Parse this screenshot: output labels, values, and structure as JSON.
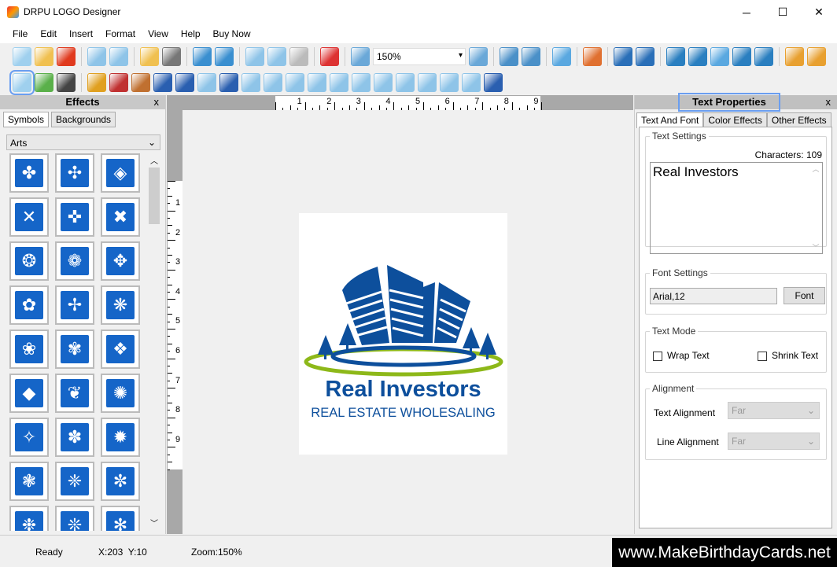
{
  "app": {
    "title": "DRPU LOGO Designer",
    "minimize": "─",
    "maximize": "☐",
    "close": "✕"
  },
  "menu": [
    "File",
    "Edit",
    "Insert",
    "Format",
    "View",
    "Help",
    "Buy Now"
  ],
  "toolbar1": [
    {
      "n": "new-icon",
      "c": "#9fd0ee"
    },
    {
      "n": "open-icon",
      "c": "#f0c050"
    },
    {
      "n": "close-file-icon",
      "c": "#e03a1e"
    },
    "|",
    {
      "n": "save-icon",
      "c": "#8ec4e8"
    },
    {
      "n": "save-as-icon",
      "c": "#8ec4e8"
    },
    "|",
    {
      "n": "export-icon",
      "c": "#f0c050"
    },
    {
      "n": "print-icon",
      "c": "#777"
    },
    "|",
    {
      "n": "undo-icon",
      "c": "#3a8fd0"
    },
    {
      "n": "redo-icon",
      "c": "#3a8fd0"
    },
    "|",
    {
      "n": "cut-icon",
      "c": "#8ec4e8"
    },
    {
      "n": "copy-icon",
      "c": "#8ec4e8"
    },
    {
      "n": "paste-icon",
      "c": "#bbb"
    },
    "|",
    {
      "n": "delete-icon",
      "c": "#d33"
    },
    "|",
    {
      "n": "zoom-in-icon",
      "c": "#6aa8d8"
    },
    "ZOOM",
    {
      "n": "zoom-out-icon",
      "c": "#6aa8d8"
    },
    "|",
    {
      "n": "actual-size-icon",
      "c": "#4a90c8"
    },
    {
      "n": "fit-icon",
      "c": "#4a90c8"
    },
    "|",
    {
      "n": "grid-icon",
      "c": "#5aa8e0"
    },
    "|",
    {
      "n": "edit-properties-icon",
      "c": "#e07030"
    },
    "|",
    {
      "n": "bring-front-icon",
      "c": "#2a6fb8"
    },
    {
      "n": "send-back-icon",
      "c": "#2a6fb8"
    },
    "|",
    {
      "n": "align-left-icon",
      "c": "#2a7fc0"
    },
    {
      "n": "align-right-icon",
      "c": "#2a7fc0"
    },
    {
      "n": "center-icon",
      "c": "#5aa8e0"
    },
    {
      "n": "align-top-icon",
      "c": "#2a7fc0"
    },
    {
      "n": "align-bottom-icon",
      "c": "#2a7fc0"
    },
    "|",
    {
      "n": "lock-icon",
      "c": "#e8a030"
    },
    {
      "n": "unlock-icon",
      "c": "#e8a030"
    }
  ],
  "zoom_value": "150%",
  "toolbar2": [
    {
      "n": "text-tool-icon",
      "c": "#9fd0ee"
    },
    {
      "n": "image-tool-icon",
      "c": "#5ab04a"
    },
    {
      "n": "camera-icon",
      "c": "#444"
    },
    "|",
    {
      "n": "layers-icon",
      "c": "#e0a020"
    },
    {
      "n": "background-icon",
      "c": "#c03030"
    },
    {
      "n": "users-icon",
      "c": "#c07030"
    },
    {
      "n": "word-art-icon",
      "c": "#2a5fb0"
    },
    {
      "n": "signature-icon",
      "c": "#2a5fb0"
    },
    {
      "n": "watermark-icon",
      "c": "#8ec4e8"
    },
    {
      "n": "line-icon",
      "c": "#2a5fb0"
    },
    {
      "n": "rectangle-icon",
      "c": "#8ec4e8"
    },
    {
      "n": "ellipse-icon",
      "c": "#8ec4e8"
    },
    {
      "n": "rounded-rect-icon",
      "c": "#8ec4e8"
    },
    {
      "n": "diamond-icon",
      "c": "#8ec4e8"
    },
    {
      "n": "star-icon",
      "c": "#8ec4e8"
    },
    {
      "n": "pie-icon",
      "c": "#8ec4e8"
    },
    {
      "n": "cross-shape-icon",
      "c": "#8ec4e8"
    },
    {
      "n": "triangle-up-icon",
      "c": "#8ec4e8"
    },
    {
      "n": "triangle-down-icon",
      "c": "#8ec4e8"
    },
    {
      "n": "triangle-right-icon",
      "c": "#8ec4e8"
    },
    {
      "n": "triangle-left-icon",
      "c": "#8ec4e8"
    },
    {
      "n": "arc-icon",
      "c": "#2a5fb0"
    }
  ],
  "effects": {
    "title": "Effects",
    "close": "x",
    "tabs": [
      "Symbols",
      "Backgrounds"
    ],
    "category": "Arts",
    "symbols": [
      "✤",
      "✣",
      "◈",
      "✕",
      "✜",
      "✖",
      "❂",
      "❁",
      "✥",
      "✿",
      "✢",
      "❋",
      "❀",
      "✾",
      "❖",
      "◆",
      "❦",
      "✺",
      "✧",
      "✽",
      "✹",
      "❃",
      "❈",
      "✼",
      "❉",
      "❊",
      "✻"
    ]
  },
  "ruler": {
    "h": [
      "1",
      "2",
      "3",
      "4",
      "5",
      "6",
      "7",
      "8",
      "9"
    ],
    "v": [
      "1",
      "2",
      "3",
      "4",
      "5",
      "6",
      "7",
      "8",
      "9"
    ]
  },
  "logo": {
    "title": "Real Investors",
    "subtitle": "REAL ESTATE WHOLESALING",
    "blue": "#0d4f9c",
    "green": "#8db819"
  },
  "props": {
    "title": "Text Properties",
    "close": "x",
    "tabs": [
      "Text And Font",
      "Color Effects",
      "Other Effects"
    ],
    "text_settings": "Text Settings",
    "characters": "Characters: 109",
    "text_value": "Real Investors",
    "font_settings": "Font Settings",
    "font_value": "Arial,12",
    "font_button": "Font",
    "text_mode": "Text Mode",
    "wrap": "Wrap Text",
    "shrink": "Shrink Text",
    "alignment": "Alignment",
    "text_alignment": "Text Alignment",
    "text_alignment_value": "Far",
    "line_alignment": "Line Alignment",
    "line_alignment_value": "Far"
  },
  "status": {
    "ready": "Ready",
    "coords": "X:203  Y:10",
    "zoom": "Zoom:150%"
  },
  "watermark": "www.MakeBirthdayCards.net"
}
